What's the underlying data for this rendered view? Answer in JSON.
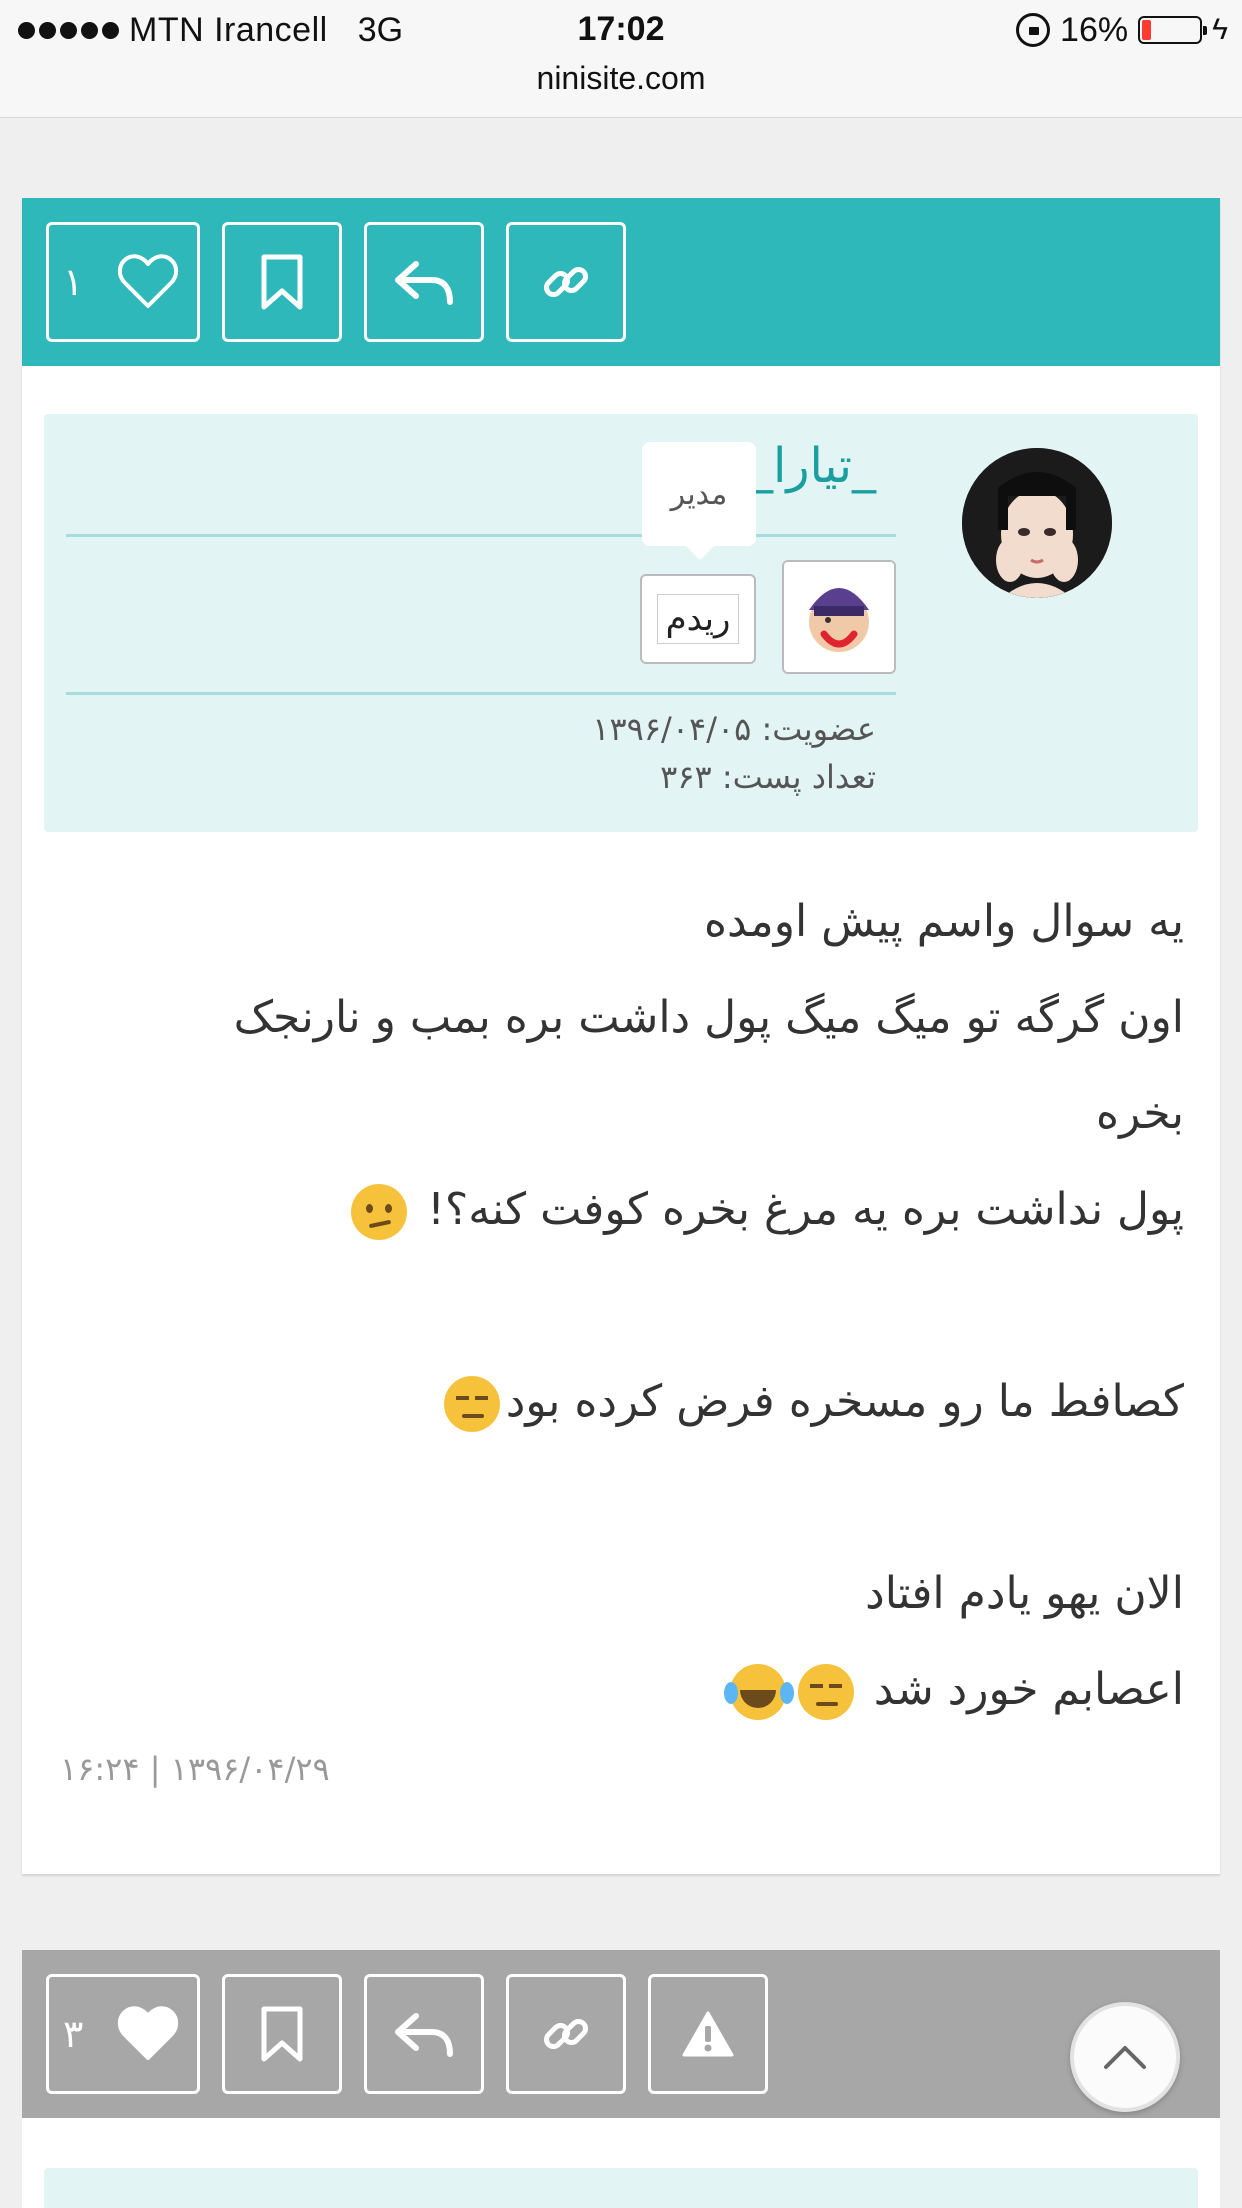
{
  "status_bar": {
    "carrier": "MTN Irancell",
    "network": "3G",
    "time": "17:02",
    "battery": "16%",
    "battery_level": 0.16
  },
  "browser": {
    "url": "ninisite.com"
  },
  "post1": {
    "toolbar": {
      "like_count": "۱"
    },
    "author": {
      "username": "_تیارا_",
      "role_tooltip": "مدیر",
      "badge_text": "ریدم",
      "membership": "عضویت: ۱۳۹۶/۰۴/۰۵",
      "post_count": "تعداد پست: ۳۶۳"
    },
    "body_lines": [
      "یه سوال واسم پیش اومده",
      "اون گرگه تو میگ میگ پول داشت بره بمب و نارنجک",
      "بخره",
      "پول نداشت بره یه مرغ بخره کوفت کنه؟!",
      "",
      "کصافط ما رو مسخره فرض کرده بود",
      "",
      "الان یهو یادم افتاد",
      "اعصابم خورد شد"
    ],
    "date": "۱۶:۲۴ | ۱۳۹۶/۰۴/۲۹"
  },
  "post2": {
    "toolbar": {
      "like_count": "۳"
    }
  },
  "colors": {
    "accent": "#2fb8b9",
    "toolbar_inactive": "#a7a7a7",
    "author_bg": "#e2f4f4"
  },
  "icons": [
    "heart-icon",
    "bookmark-icon",
    "reply-icon",
    "link-icon",
    "warning-icon",
    "chevron-up-icon"
  ]
}
